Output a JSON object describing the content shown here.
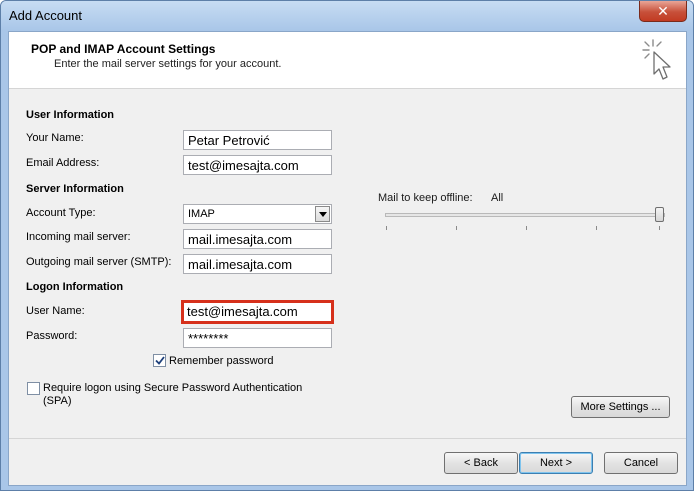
{
  "window": {
    "title": "Add Account",
    "close_symbol": "✕"
  },
  "header": {
    "title": "POP and IMAP Account Settings",
    "subtitle": "Enter the mail server settings for your account.",
    "icon": "cursor-click-icon"
  },
  "user_info": {
    "heading": "User Information",
    "name_label": "Your Name:",
    "name_value": "Petar Petrović",
    "email_label": "Email Address:",
    "email_value": "test@imesajta.com"
  },
  "server_info": {
    "heading": "Server Information",
    "account_type_label": "Account Type:",
    "account_type_value": "IMAP",
    "incoming_label": "Incoming mail server:",
    "incoming_value": "mail.imesajta.com",
    "outgoing_label": "Outgoing mail server (SMTP):",
    "outgoing_value": "mail.imesajta.com"
  },
  "logon_info": {
    "heading": "Logon Information",
    "username_label": "User Name:",
    "username_value": "test@imesajta.com",
    "password_label": "Password:",
    "password_value": "********",
    "remember_label": "Remember password",
    "remember_checked": true,
    "spa_label_line1": "Require logon using Secure Password Authentication",
    "spa_label_line2": "(SPA)",
    "spa_checked": false
  },
  "offline": {
    "label": "Mail to keep offline:",
    "value": "All",
    "slider_fraction": 1.0
  },
  "buttons": {
    "more_settings": "More Settings ...",
    "back": "< Back",
    "next": "Next >",
    "cancel": "Cancel"
  },
  "colors": {
    "highlight": "#d6301b",
    "titlebar": "#a9c6e8"
  }
}
